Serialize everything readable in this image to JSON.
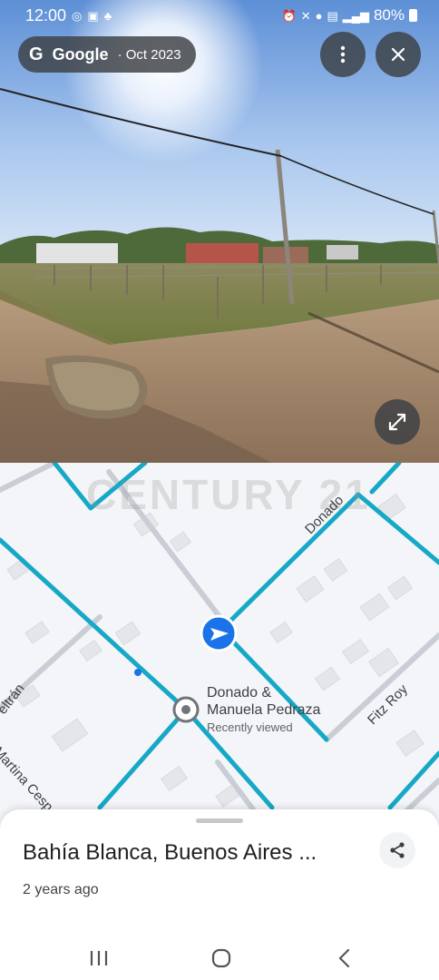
{
  "status_bar": {
    "time": "12:00",
    "battery": "80%"
  },
  "street_view": {
    "source": "Google",
    "date": "· Oct 2023",
    "icons": {
      "more": "more-vert-icon",
      "close": "close-icon",
      "expand": "expand-icon"
    }
  },
  "map": {
    "watermark": "CENTURY 21",
    "streets": {
      "donado": "Donado",
      "fitz_roy": "Fitz Roy",
      "beltran": "eltrán",
      "martina": "Martina Cesp"
    },
    "place": {
      "name_line1": "Donado &",
      "name_line2": "Manuela Pedraza",
      "subtitle": "Recently viewed"
    },
    "colors": {
      "road_highlight": "#16a8c7",
      "location_marker": "#1a73e8"
    }
  },
  "sheet": {
    "title": "Bahía Blanca, Buenos Aires ...",
    "subtitle": "2 years ago"
  }
}
